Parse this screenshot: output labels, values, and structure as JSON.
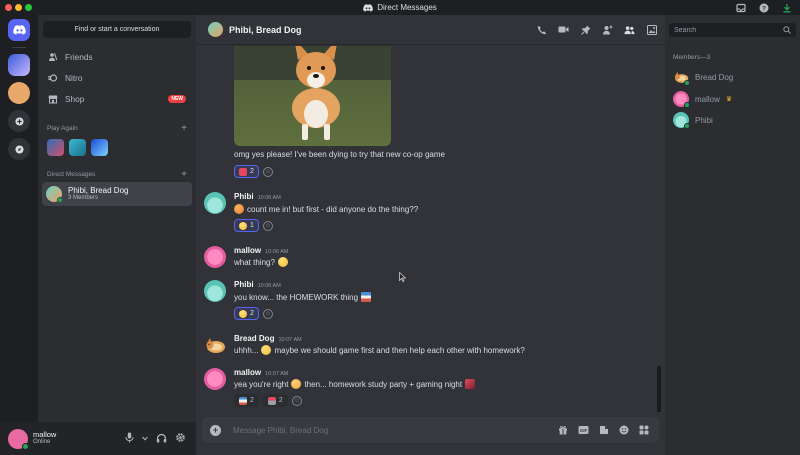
{
  "window": {
    "title": "Direct Messages"
  },
  "sidebar": {
    "search_label": "Find or start a conversation",
    "nav": [
      {
        "label": "Friends",
        "icon": "friends-icon"
      },
      {
        "label": "Nitro",
        "icon": "nitro-icon"
      },
      {
        "label": "Shop",
        "icon": "shop-icon",
        "badge": "NEW"
      }
    ],
    "play_again_label": "Play Again",
    "dm_label": "Direct Messages",
    "dm_items": [
      {
        "name": "Phibi, Bread Dog",
        "subtitle": "3 Members"
      }
    ]
  },
  "user": {
    "name": "mallow",
    "status": "Online"
  },
  "chat": {
    "title": "Phibi, Bread Dog",
    "composer_placeholder": "Message Phibi, Bread Dog",
    "messages": [
      {
        "text": "omg yes please! I've been dying to try that new co-op game",
        "reactions": [
          {
            "count": "2"
          }
        ]
      },
      {
        "author": "Phibi",
        "time": "10:06 AM",
        "text": "count me in! but first - did anyone do the thing??",
        "reactions": [
          {
            "count": "1"
          }
        ]
      },
      {
        "author": "mallow",
        "time": "10:06 AM",
        "text": "what thing?"
      },
      {
        "author": "Phibi",
        "time": "10:06 AM",
        "text": "you know... the HOMEWORK thing",
        "reactions": [
          {
            "count": "2"
          }
        ]
      },
      {
        "author": "Bread Dog",
        "time": "10:07 AM",
        "text_before": "uhhh...",
        "text_after": "maybe we should game first and then help each other with homework?"
      },
      {
        "author": "mallow",
        "time": "10:07 AM",
        "text_before": "yea you're right",
        "text_after": "then... homework study party + gaming night",
        "reactions": [
          {
            "count": "2"
          },
          {
            "count": "2"
          }
        ]
      }
    ]
  },
  "members": {
    "search_placeholder": "Search",
    "header": "Members—3",
    "list": [
      {
        "name": "Bread Dog"
      },
      {
        "name": "mallow"
      },
      {
        "name": "Phibi"
      }
    ]
  },
  "colors": {
    "accent": "#5865f2",
    "online": "#23a55a",
    "danger": "#f23f42"
  }
}
